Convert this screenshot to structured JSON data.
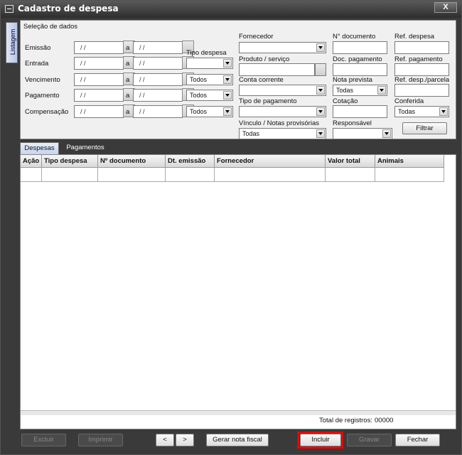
{
  "window": {
    "title": "Cadastro de despesa",
    "close_label": "X"
  },
  "side_tab": {
    "label": "Listagem"
  },
  "filters": {
    "section_title": "Seleção de dados",
    "date_rows": [
      {
        "label": "Emissão",
        "from": "/ /",
        "to": "/ /"
      },
      {
        "label": "Entrada",
        "from": "/ /",
        "to": "/ /"
      },
      {
        "label": "Vencimento",
        "from": "/ /",
        "to": "/ /"
      },
      {
        "label": "Pagamento",
        "from": "/ /",
        "to": "/ /"
      },
      {
        "label": "Compensação",
        "from": "/ /",
        "to": "/ /"
      }
    ],
    "range_separator": "a",
    "tipo_despesa": {
      "label": "Tipo despesa",
      "value": ""
    },
    "status_selects": [
      "Todos",
      "Todos",
      "Todos"
    ],
    "fornecedor": {
      "label": "Fornecedor",
      "value": ""
    },
    "produto_servico": {
      "label": "Produto / serviço",
      "value": ""
    },
    "conta_corrente": {
      "label": "Conta corrente",
      "value": ""
    },
    "tipo_pagamento": {
      "label": "Tipo de pagamento",
      "value": ""
    },
    "vinculo": {
      "label": "Vínculo / Notas provisórias",
      "value": "Todas"
    },
    "n_documento": {
      "label": "N° documento",
      "value": ""
    },
    "doc_pagamento": {
      "label": "Doc. pagamento",
      "value": ""
    },
    "nota_prevista": {
      "label": "Nota prevista",
      "value": "Todas"
    },
    "cotacao": {
      "label": "Cotação",
      "value": ""
    },
    "responsavel": {
      "label": "Responsável",
      "value": ""
    },
    "ref_despesa": {
      "label": "Ref. despesa",
      "value": ""
    },
    "ref_pagamento": {
      "label": "Ref. pagamento",
      "value": ""
    },
    "ref_desp_parcela": {
      "label": "Ref. desp./parcela",
      "value": ""
    },
    "conferida": {
      "label": "Conferida",
      "value": "Todas"
    },
    "filter_button": "Filtrar"
  },
  "tabs": [
    {
      "label": "Despesas",
      "active": true
    },
    {
      "label": "Pagamentos",
      "active": false
    }
  ],
  "table": {
    "columns": [
      "Ação",
      "Tipo despesa",
      "Nº documento",
      "Dt. emissão",
      "Fornecedor",
      "Valor total",
      "Animais"
    ],
    "rows": []
  },
  "totals": {
    "label": "Total de registros:",
    "value": "00000"
  },
  "footer": {
    "excluir": "Excluir",
    "imprimir": "Imprimir",
    "prev": "<",
    "next": ">",
    "gerar_nota": "Gerar nota fiscal",
    "incluir": "Incluir",
    "gravar": "Gravar",
    "fechar": "Fechar"
  },
  "colors": {
    "highlight": "#e00000",
    "title_bg": "#3a3a3a",
    "tab_active": "#c6d4ee"
  }
}
